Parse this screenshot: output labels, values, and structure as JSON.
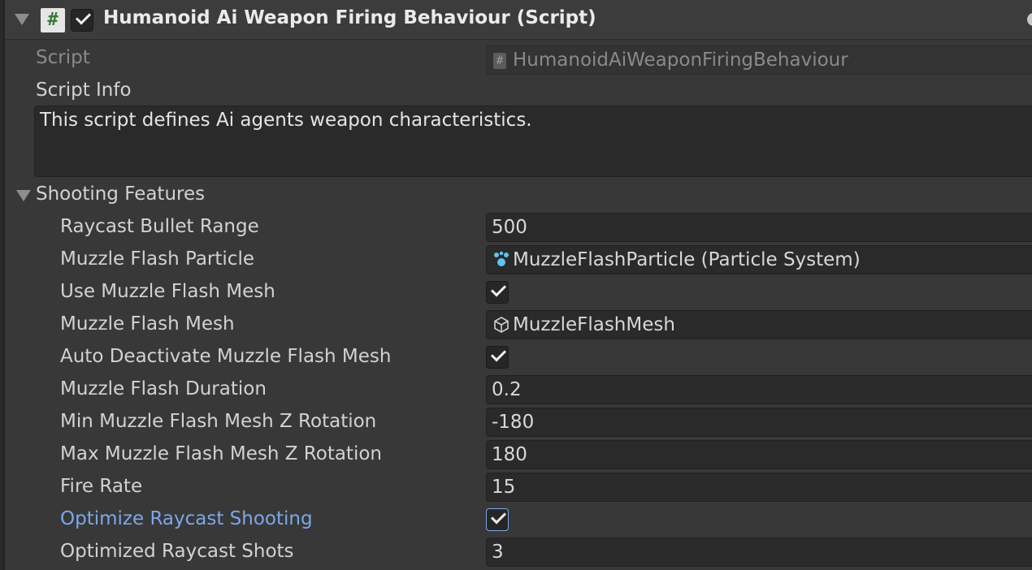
{
  "header": {
    "title": "Humanoid Ai Weapon Firing Behaviour (Script)",
    "script_icon_glyph": "#",
    "enabled": true
  },
  "script_field": {
    "label": "Script",
    "value": "HumanoidAiWeaponFiringBehaviour",
    "icon_glyph": "#"
  },
  "script_info": {
    "label": "Script Info",
    "value": "This script defines Ai agents weapon characteristics."
  },
  "shooting_features": {
    "label": "Shooting Features",
    "expanded": true,
    "raycast_bullet_range": {
      "label": "Raycast Bullet Range",
      "value": "500"
    },
    "muzzle_flash_particle": {
      "label": "Muzzle Flash Particle",
      "value": "MuzzleFlashParticle (Particle System)",
      "icon": "particle-system-icon"
    },
    "use_muzzle_flash_mesh": {
      "label": "Use Muzzle Flash Mesh",
      "checked": true
    },
    "muzzle_flash_mesh": {
      "label": "Muzzle Flash Mesh",
      "value": "MuzzleFlashMesh",
      "icon": "mesh-icon"
    },
    "auto_deactivate_muzzle_flash_mesh": {
      "label": "Auto Deactivate Muzzle Flash Mesh",
      "checked": true
    },
    "muzzle_flash_duration": {
      "label": "Muzzle Flash Duration",
      "value": "0.2"
    },
    "min_muzzle_flash_mesh_z_rotation": {
      "label": "Min Muzzle Flash Mesh Z Rotation",
      "value": "-180"
    },
    "max_muzzle_flash_mesh_z_rotation": {
      "label": "Max Muzzle Flash Mesh Z Rotation",
      "value": "180"
    },
    "fire_rate": {
      "label": "Fire Rate",
      "value": "15"
    },
    "optimize_raycast_shooting": {
      "label": "Optimize Raycast Shooting",
      "checked": true
    },
    "optimized_raycast_shots": {
      "label": "Optimized Raycast Shots",
      "value": "3"
    }
  },
  "colors": {
    "background": "#383838",
    "field_background": "#2a2a2a",
    "highlight_label": "#7ba7ea",
    "script_icon_green": "#3a7a3a",
    "particle_icon": "#5fc3ee"
  }
}
